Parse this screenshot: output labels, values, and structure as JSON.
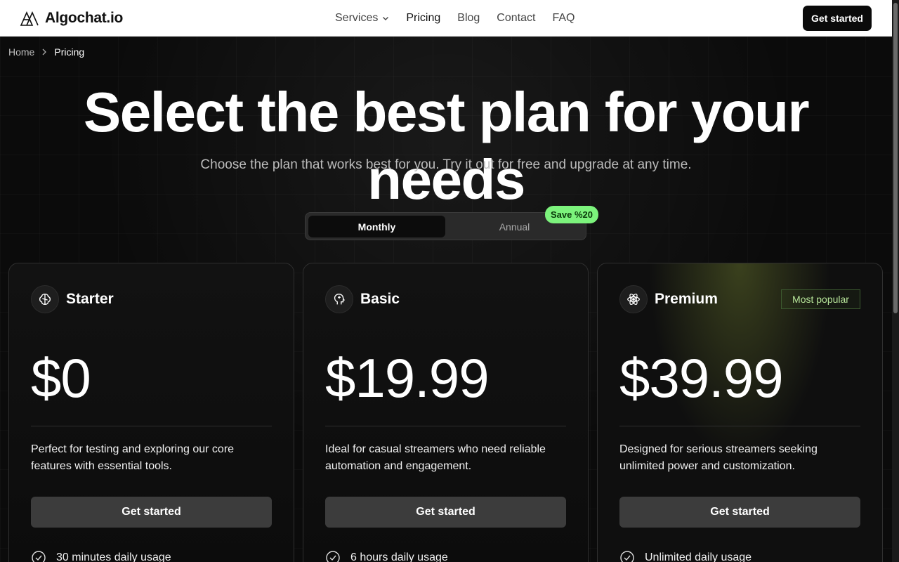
{
  "brand": {
    "name": "Algochat.io"
  },
  "nav": {
    "links": [
      {
        "label": "Services"
      },
      {
        "label": "Pricing"
      },
      {
        "label": "Blog"
      },
      {
        "label": "Contact"
      },
      {
        "label": "FAQ"
      }
    ],
    "cta": "Get started"
  },
  "breadcrumb": {
    "home": "Home",
    "current": "Pricing"
  },
  "hero": {
    "title": "Select the best plan for your needs",
    "subtitle": "Choose the plan that works best for you. Try it out for free and upgrade at any time."
  },
  "billing_toggle": {
    "monthly": "Monthly",
    "annual": "Annual",
    "save_badge": "Save %20",
    "selected": "Monthly"
  },
  "plans": [
    {
      "name": "Starter",
      "icon": "brain-icon",
      "price": "$0",
      "description": "Perfect for testing and exploring our core features with essential tools.",
      "cta": "Get started",
      "feature": "30 minutes daily usage"
    },
    {
      "name": "Basic",
      "icon": "head-icon",
      "price": "$19.99",
      "description": "Ideal for casual streamers who need reliable automation and engagement.",
      "cta": "Get started",
      "feature": "6 hours daily usage"
    },
    {
      "name": "Premium",
      "icon": "atom-icon",
      "price": "$39.99",
      "badge": "Most popular",
      "description": "Designed for serious streamers seeking unlimited power and customization.",
      "cta": "Get started",
      "feature": "Unlimited daily usage"
    }
  ],
  "colors": {
    "accent_green": "#7cf37c",
    "popular_text": "#b7e59a",
    "nav_bg": "#ffffff",
    "page_bg": "#0b0b0b"
  }
}
